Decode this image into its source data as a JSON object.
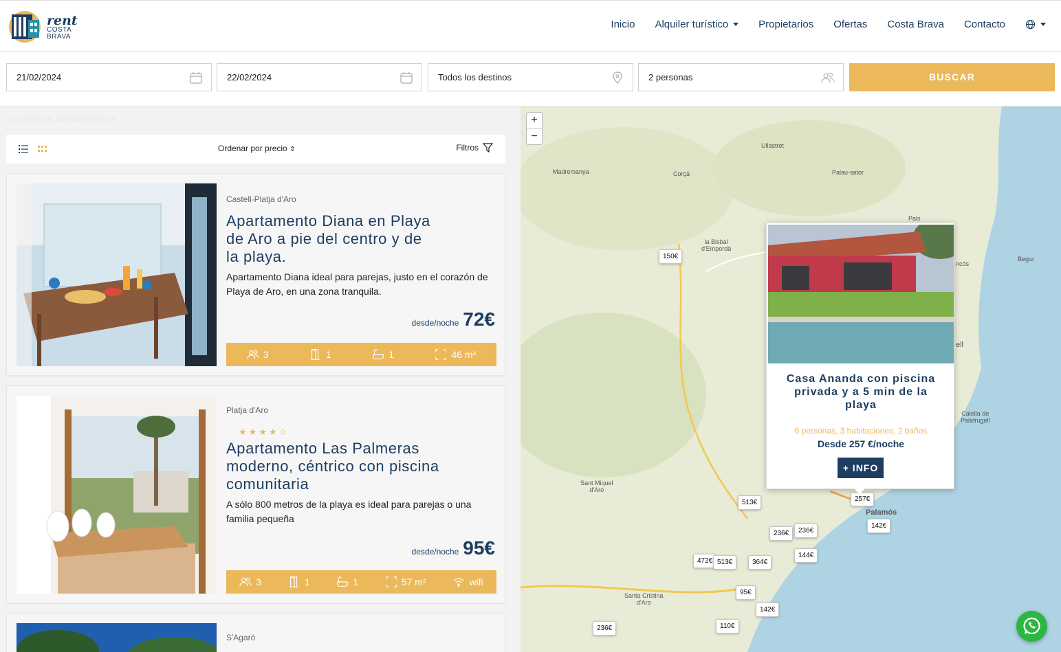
{
  "brand": {
    "name": "rent",
    "sub1": "COSTA",
    "sub2": "BRAVA"
  },
  "nav": [
    {
      "label": "Inicio"
    },
    {
      "label": "Alquiler turístico",
      "dropdown": true
    },
    {
      "label": "Propietarios"
    },
    {
      "label": "Ofertas"
    },
    {
      "label": "Costa Brava"
    },
    {
      "label": "Contacto"
    }
  ],
  "search": {
    "checkin": "21/02/2024",
    "checkout": "22/02/2024",
    "destination": "Todos los destinos",
    "guests": "2 personas",
    "button": "BUSCAR"
  },
  "listing": {
    "title": "LISTADO DE ALOJAMIENTOS",
    "sort_label": "Ordenar por precio",
    "filters_label": "Filtros",
    "items": [
      {
        "location": "Castell-Platja d'Aro",
        "title": "Apartamento Diana en Playa de Aro a pie del centro y de la playa.",
        "description": "Apartamento Diana ideal para parejas, justo en el corazón de Playa de Aro, en una zona tranquila.",
        "price_from": "desde/noche",
        "price": "72€",
        "features": {
          "guests": "3",
          "rooms": "1",
          "baths": "1",
          "area": "46 m²"
        }
      },
      {
        "location": "Platja d'Aro",
        "rating": 4,
        "title": "Apartamento Las Palmeras moderno, céntrico con piscina comunitaria",
        "description": "A sólo 800 metros de la playa es ideal para parejas o una familia pequeña",
        "price_from": "desde/noche",
        "price": "95€",
        "features": {
          "guests": "3",
          "rooms": "1",
          "baths": "1",
          "area": "57 m²",
          "wifi": "wifi"
        }
      },
      {
        "location": "S'Agaró"
      }
    ]
  },
  "map": {
    "zoom_in": "+",
    "zoom_out": "−",
    "towns": {
      "ullastret": "Ullastret",
      "madremanya": "Madremanya",
      "corca": "Corçà",
      "palau": "Palau-sator",
      "pals": "Pals",
      "bisbal1": "la Bisbal",
      "bisbal2": "d'Empordà",
      "begur": "Begur",
      "calella1": "Calella de",
      "calella2": "Palafrugell",
      "sant_miquel1": "Sant Miquel",
      "sant_miquel2": "d'Aro",
      "santa_cristina1": "Santa Cristina",
      "santa_cristina2": "d'Aro",
      "palamos": "Palamós",
      "fragment_concos": "ncós",
      "fragment_ell": "ell"
    },
    "pins": {
      "p150": "150€",
      "p513a": "513€",
      "p257": "257€",
      "p142a": "142€",
      "p236a": "236€",
      "p236b": "236€",
      "p144": "144€",
      "p364": "364€",
      "p472": "472€",
      "p513b": "513€",
      "p95": "95€",
      "p142b": "142€",
      "p110": "110€",
      "p236c": "236€"
    },
    "popup": {
      "title": "Casa Ananda con piscina privada y a 5 min de la playa",
      "meta": "6 personas,  3 habitaciones,  2 baños",
      "price": "Desde 257 €/noche",
      "button": "+ INFO"
    }
  },
  "colors": {
    "accent": "#ebb85a",
    "navy": "#1d3d61",
    "whatsapp": "#2db742"
  }
}
